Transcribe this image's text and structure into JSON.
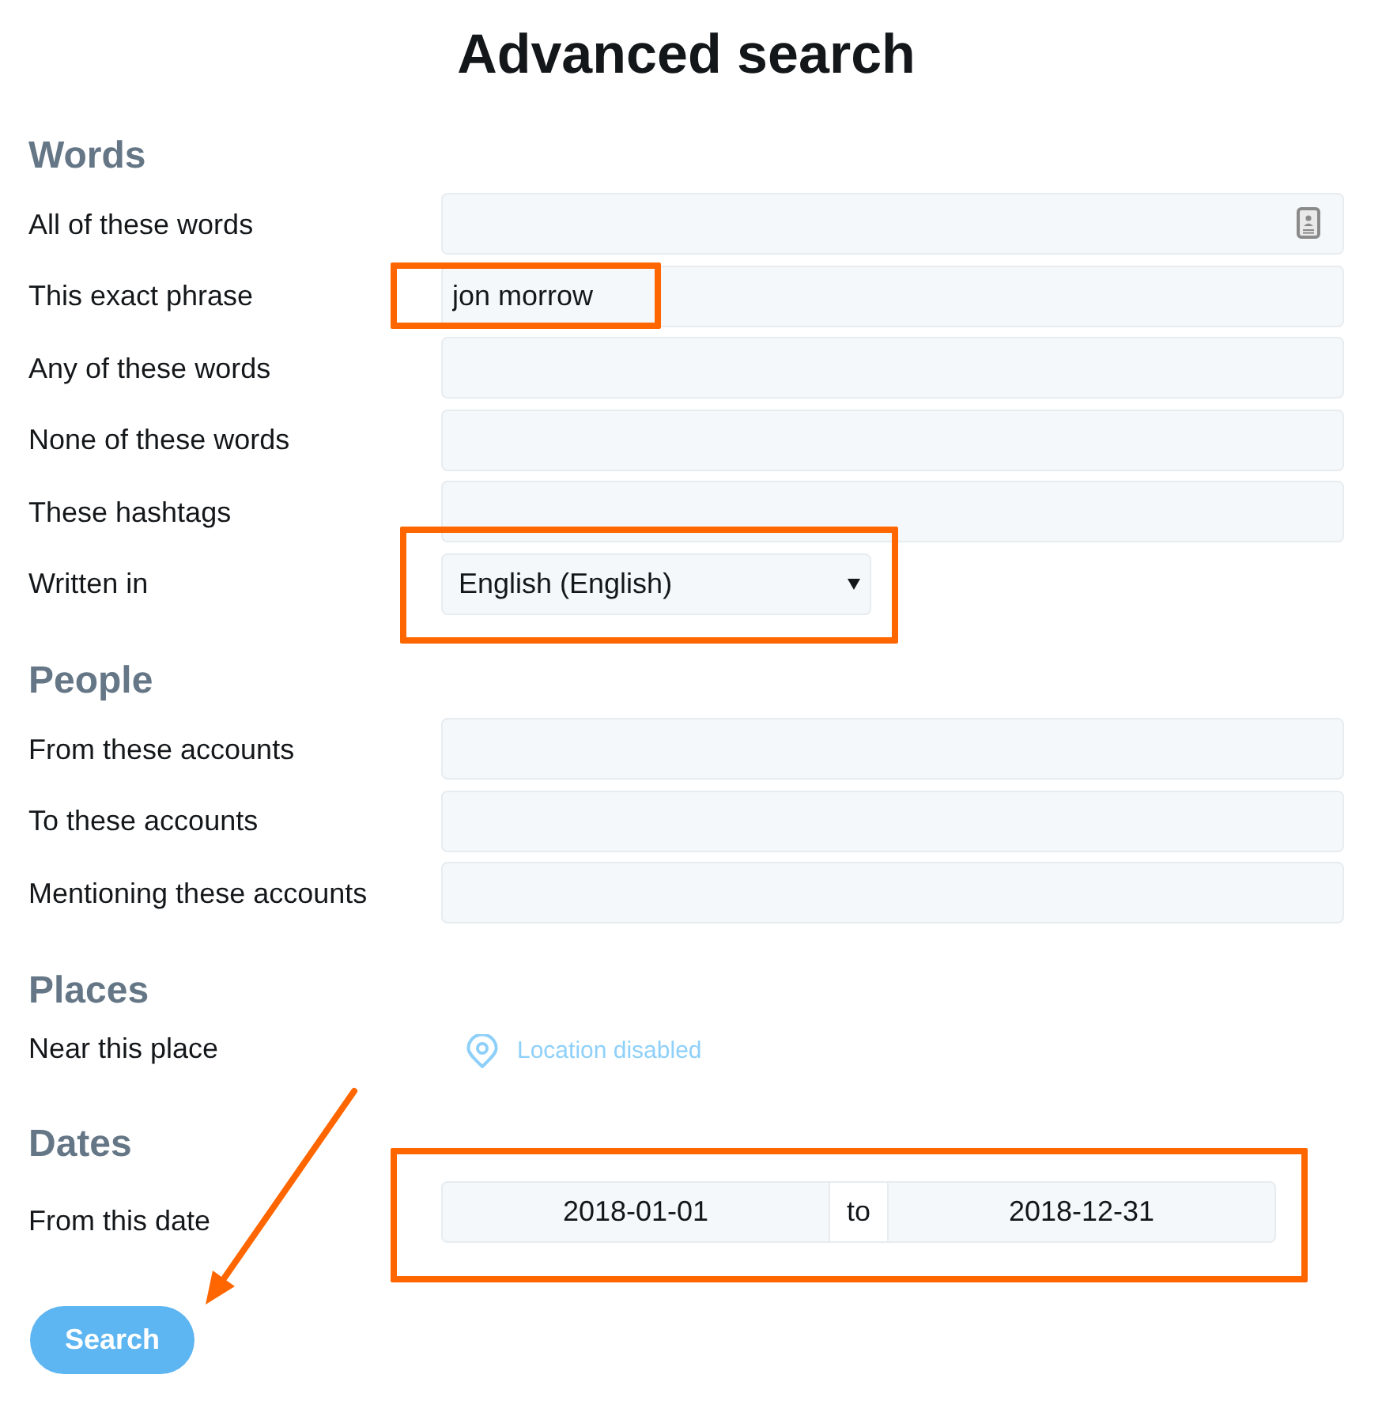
{
  "title": "Advanced search",
  "sections": [
    {
      "heading": "Words",
      "rows": [
        {
          "kind": "input-icon",
          "label": "All of these words",
          "highlighted": false
        },
        {
          "kind": "input",
          "label": "This exact phrase",
          "value": "jon morrow",
          "highlighted": true
        },
        {
          "kind": "input",
          "label": "Any of these words",
          "highlighted": false
        },
        {
          "kind": "input",
          "label": "None of these words",
          "highlighted": false
        },
        {
          "kind": "input",
          "label": "These hashtags",
          "highlighted": false
        },
        {
          "kind": "select",
          "label": "Written in",
          "value": "English (English)",
          "highlighted": true
        }
      ]
    },
    {
      "heading": "People",
      "rows": [
        {
          "kind": "input",
          "label": "From these accounts",
          "highlighted": false
        },
        {
          "kind": "input",
          "label": "To these accounts",
          "highlighted": false
        },
        {
          "kind": "input",
          "label": "Mentioning these accounts",
          "highlighted": false
        }
      ]
    },
    {
      "heading": "Places",
      "rows": [
        {
          "kind": "location",
          "label": "Near this place",
          "status": "Location disabled",
          "highlighted": false
        }
      ]
    },
    {
      "heading": "Dates",
      "rows": [
        {
          "kind": "date-range",
          "label": "From this date",
          "from": "2018-01-01",
          "separator": "to",
          "to": "2018-12-31",
          "highlighted": true
        }
      ]
    }
  ],
  "search_button": {
    "label": "Search",
    "annotation_arrow": true
  }
}
